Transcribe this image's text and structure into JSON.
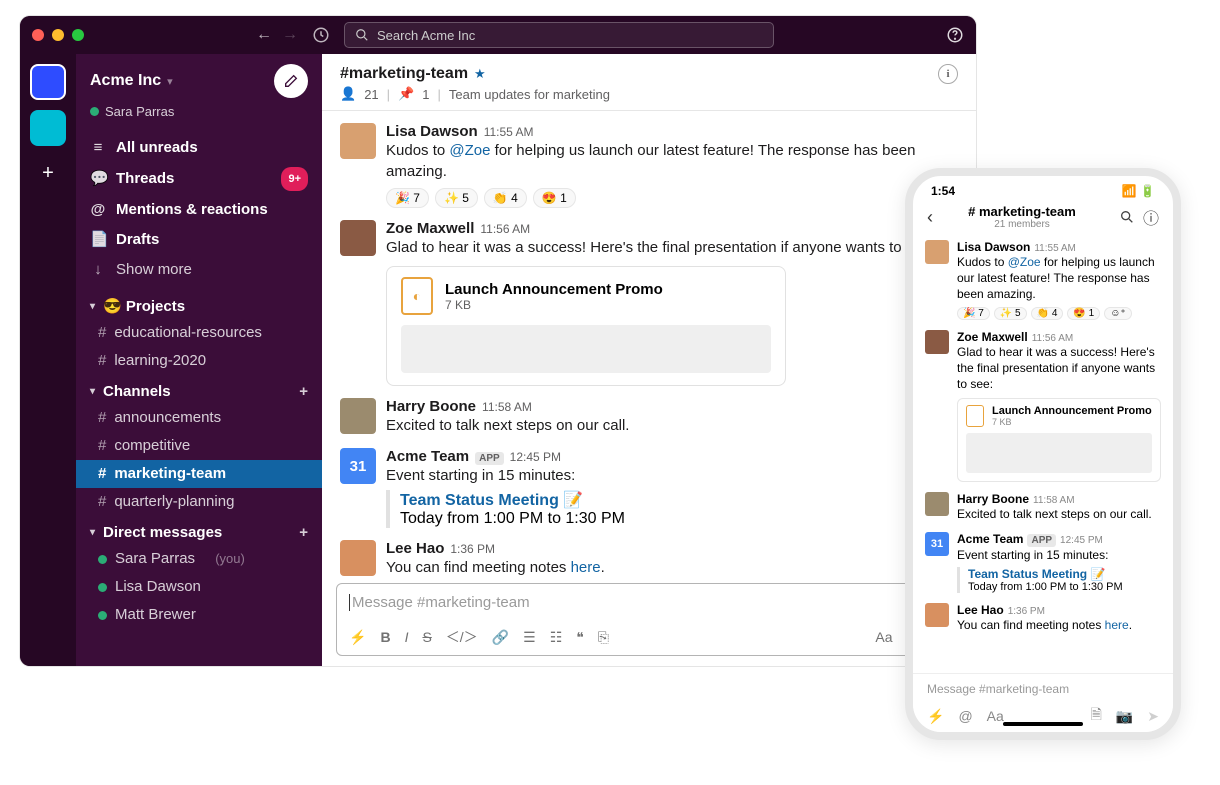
{
  "colors": {
    "traffic_red": "#FF5F57",
    "traffic_yellow": "#FEBC2E",
    "traffic_green": "#28C840"
  },
  "search": {
    "placeholder": "Search Acme Inc"
  },
  "workspace": {
    "name": "Acme Inc",
    "user": "Sara Parras"
  },
  "nav": {
    "unreads": "All unreads",
    "threads": "Threads",
    "threads_badge": "9+",
    "mentions": "Mentions & reactions",
    "drafts": "Drafts",
    "more": "Show more"
  },
  "sections": {
    "projects": {
      "title": "😎 Projects",
      "items": [
        "educational-resources",
        "learning-2020"
      ]
    },
    "channels": {
      "title": "Channels",
      "items": [
        "announcements",
        "competitive",
        "marketing-team",
        "quarterly-planning"
      ],
      "selected": "marketing-team"
    },
    "dms": {
      "title": "Direct messages",
      "items": [
        {
          "name": "Sara Parras",
          "you": "(you)"
        },
        {
          "name": "Lisa Dawson"
        },
        {
          "name": "Matt Brewer"
        }
      ]
    }
  },
  "channel": {
    "name": "#marketing-team",
    "members": "21",
    "pins": "1",
    "topic": "Team updates for marketing"
  },
  "messages": [
    {
      "author": "Lisa Dawson",
      "time": "11:55 AM",
      "text_pre": "Kudos to ",
      "mention": "@Zoe",
      "text_post": " for helping us launch our latest feature! The response has been amazing.",
      "avatar_bg": "#D8A070",
      "reactions": [
        {
          "e": "🎉",
          "c": "7"
        },
        {
          "e": "✨",
          "c": "5"
        },
        {
          "e": "👏",
          "c": "4"
        },
        {
          "e": "😍",
          "c": "1"
        }
      ]
    },
    {
      "author": "Zoe Maxwell",
      "time": "11:56 AM",
      "text": "Glad to hear it was a success! Here's the final presentation if anyone wants to see:",
      "avatar_bg": "#8A5A44",
      "attachment": {
        "title": "Launch Announcement Promo",
        "size": "7 KB"
      }
    },
    {
      "author": "Harry Boone",
      "time": "11:58 AM",
      "text": "Excited to talk next steps on our call.",
      "avatar_bg": "#9B8B6E"
    },
    {
      "author": "Acme Team",
      "time": "12:45 PM",
      "app": "APP",
      "text": "Event starting in 15 minutes:",
      "avatar_bg": "#4285F4",
      "avatar_label": "31",
      "avatar_white": true,
      "event": {
        "title": "Team Status Meeting",
        "emoji": "📝",
        "time": "Today from 1:00 PM to 1:30 PM"
      }
    },
    {
      "author": "Lee Hao",
      "time": "1:36 PM",
      "text_pre": "You can find meeting notes ",
      "link": "here",
      "text_post": ".",
      "avatar_bg": "#D89060"
    }
  ],
  "composer": {
    "placeholder": "Message #marketing-team"
  },
  "mobile": {
    "time": "1:54",
    "title": "# marketing-team",
    "members": "21 members",
    "placeholder": "Message #marketing-team"
  }
}
